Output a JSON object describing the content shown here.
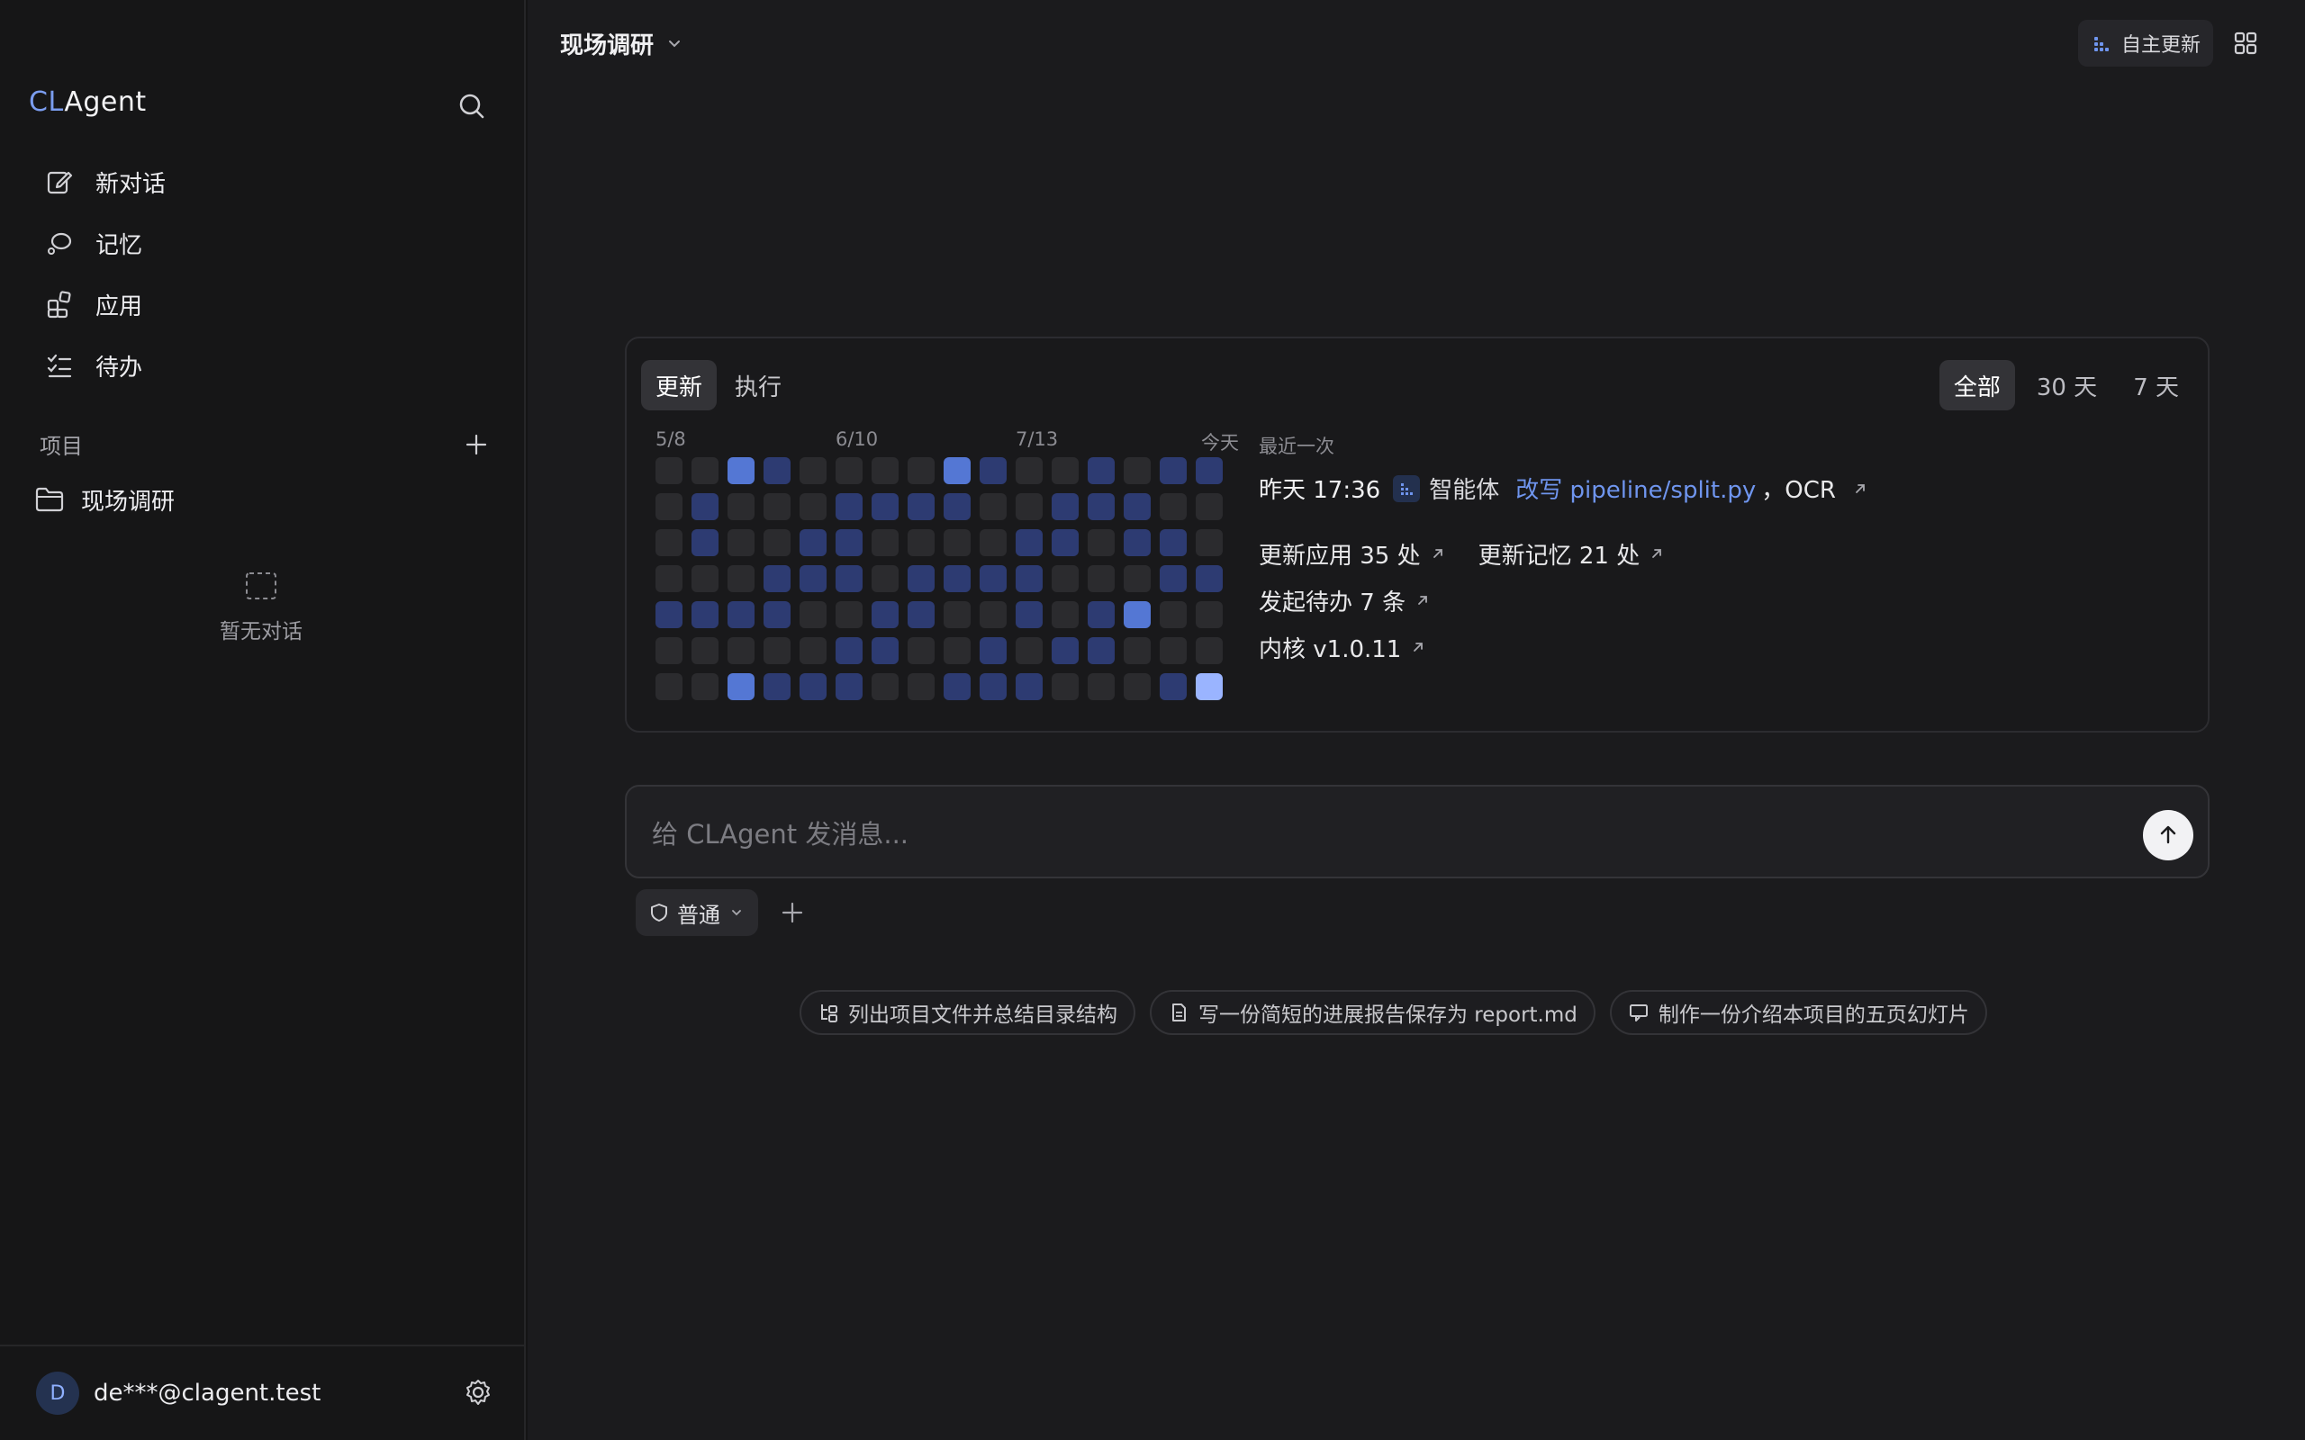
{
  "sidebar": {
    "brand_prefix": "CL",
    "brand_suffix": "Agent",
    "nav": [
      {
        "label": "新对话",
        "icon": "edit-icon"
      },
      {
        "label": "记忆",
        "icon": "memory-icon"
      },
      {
        "label": "应用",
        "icon": "apps-icon"
      },
      {
        "label": "待办",
        "icon": "todo-icon"
      }
    ],
    "projects_label": "项目",
    "project_name": "现场调研",
    "empty_label": "暂无对话",
    "user_initial": "D",
    "user_email": "de***@clagent.test"
  },
  "header": {
    "title": "现场调研",
    "auto_update_label": "自主更新"
  },
  "activity": {
    "tabs": [
      "更新",
      "执行"
    ],
    "active_tab": "更新",
    "ranges": [
      "全部",
      "30 天",
      "7 天"
    ],
    "active_range": "全部",
    "month_labels": [
      "5/8",
      "6/10",
      "7/13",
      "今天"
    ],
    "levels": [
      [
        0,
        0,
        0,
        0,
        1,
        0,
        0
      ],
      [
        0,
        1,
        1,
        0,
        1,
        0,
        0
      ],
      [
        2,
        0,
        0,
        0,
        1,
        0,
        2
      ],
      [
        1,
        0,
        0,
        1,
        1,
        0,
        1
      ],
      [
        0,
        0,
        1,
        1,
        0,
        0,
        1
      ],
      [
        0,
        1,
        1,
        1,
        0,
        1,
        1
      ],
      [
        0,
        1,
        0,
        0,
        1,
        1,
        0
      ],
      [
        0,
        1,
        0,
        1,
        1,
        0,
        0
      ],
      [
        2,
        1,
        0,
        1,
        0,
        0,
        1
      ],
      [
        1,
        0,
        0,
        1,
        0,
        1,
        1
      ],
      [
        0,
        0,
        1,
        1,
        1,
        0,
        1
      ],
      [
        0,
        1,
        1,
        0,
        0,
        1,
        0
      ],
      [
        1,
        1,
        0,
        0,
        1,
        1,
        0
      ],
      [
        0,
        1,
        1,
        0,
        2,
        0,
        0
      ],
      [
        1,
        0,
        1,
        1,
        0,
        0,
        1
      ],
      [
        1,
        0,
        0,
        1,
        0,
        0,
        3
      ]
    ],
    "colors": [
      "#2b2b2e",
      "#2d3b72",
      "#5477d4",
      "#9ab4ff"
    ],
    "recent_header": "最近一次",
    "recent": {
      "time": "昨天 17:36",
      "agent": "智能体",
      "action": "改写 pipeline/split.py",
      "target": "，OCR"
    },
    "stats": {
      "apps": "更新应用 35 处",
      "memory": "更新记忆 21 处",
      "todos": "发起待办 7 条",
      "kernel": "内核 v1.0.11"
    }
  },
  "composer": {
    "placeholder": "给 CLAgent 发消息...",
    "mode_label": "普通"
  },
  "suggestions": [
    {
      "label": "列出项目文件并总结目录结构",
      "icon": "tree-icon"
    },
    {
      "label": "写一份简短的进展报告保存为 report.md",
      "icon": "document-icon"
    },
    {
      "label": "制作一份介绍本项目的五页幻灯片",
      "icon": "presentation-icon"
    }
  ]
}
